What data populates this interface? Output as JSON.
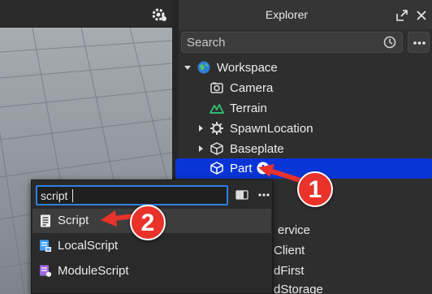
{
  "explorer": {
    "title": "Explorer",
    "search_placeholder": "Search"
  },
  "tree": [
    {
      "label": "Workspace",
      "icon": "workspace-icon"
    },
    {
      "label": "Camera",
      "icon": "camera-icon"
    },
    {
      "label": "Terrain",
      "icon": "terrain-icon"
    },
    {
      "label": "SpawnLocation",
      "icon": "spawn-location-icon"
    },
    {
      "label": "Baseplate",
      "icon": "part-icon"
    },
    {
      "label": "Part",
      "icon": "part-icon",
      "selected": true
    }
  ],
  "background_items": [
    "ervice",
    "Client",
    "dFirst",
    "dStorage"
  ],
  "insert_popup": {
    "search_value": "script",
    "items": [
      {
        "label": "Script",
        "icon": "script-icon"
      },
      {
        "label": "LocalScript",
        "icon": "local-script-icon"
      },
      {
        "label": "ModuleScript",
        "icon": "module-script-icon"
      }
    ]
  },
  "annotations": {
    "badge_1": "1",
    "badge_2": "2"
  },
  "colors": {
    "selection": "#0a35d6",
    "badge": "#e8322a",
    "focus_border": "#2f7fe0",
    "terrain": "#2fbf71",
    "script_purple": "#a066e0"
  }
}
